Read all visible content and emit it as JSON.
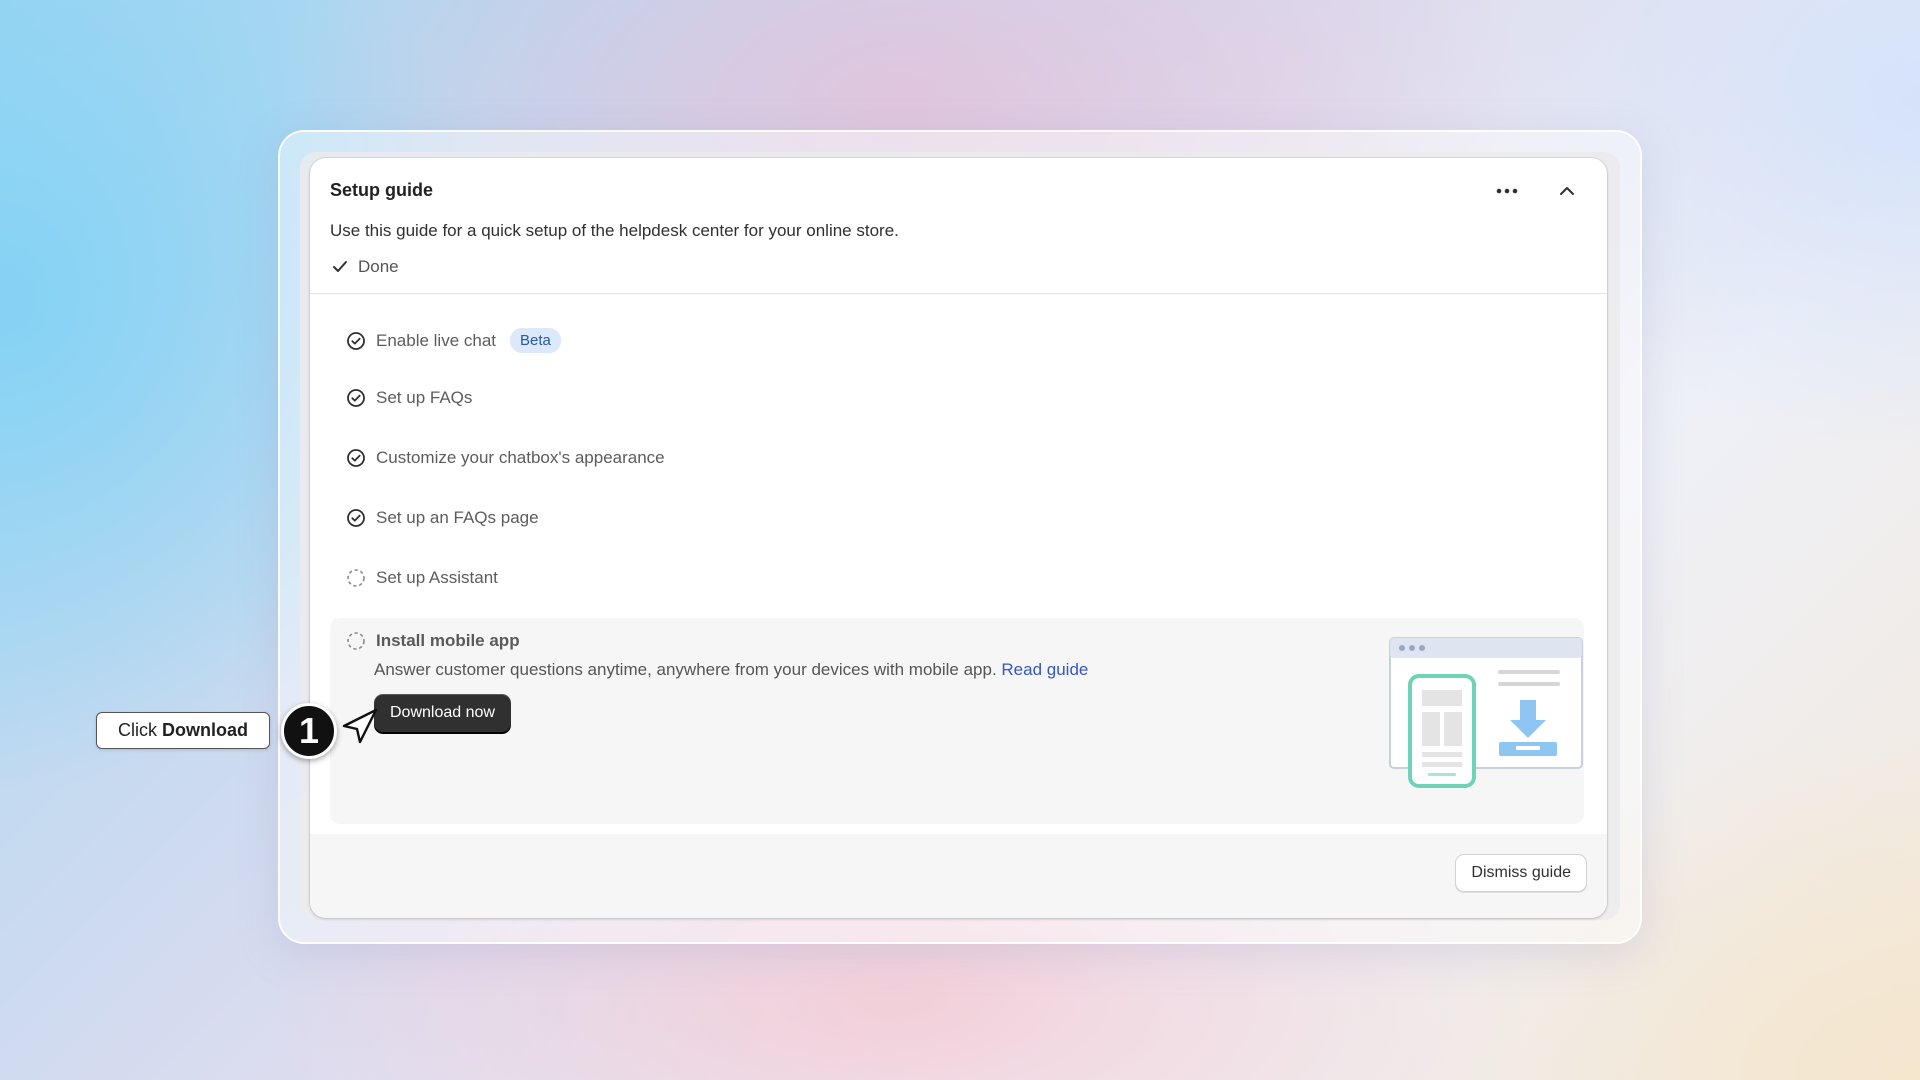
{
  "guide": {
    "title": "Setup guide",
    "subtitle": "Use this guide for a quick setup of the helpdesk center for your online store.",
    "done_label": "Done",
    "more_icon": "ellipsis-icon",
    "collapse_icon": "chevron-up-icon"
  },
  "tasks": [
    {
      "label": "Enable live chat",
      "status": "complete",
      "badge": "Beta"
    },
    {
      "label": "Set up FAQs",
      "status": "complete"
    },
    {
      "label": "Customize your chatbox's appearance",
      "status": "complete"
    },
    {
      "label": "Set up an FAQs page",
      "status": "complete"
    },
    {
      "label": "Set up Assistant",
      "status": "incomplete"
    }
  ],
  "expanded_task": {
    "title": "Install mobile app",
    "status": "incomplete",
    "description": "Answer customer questions anytime, anywhere from your devices with mobile app.",
    "link_label": "Read guide",
    "button_label": "Download now"
  },
  "footer": {
    "dismiss_label": "Dismiss guide"
  },
  "annotation": {
    "step_number": "1",
    "callout_prefix": "Click",
    "callout_emphasis": "Download"
  },
  "colors": {
    "link": "#3556c4",
    "beta_bg": "#dbe9fb",
    "beta_text": "#2b57a4",
    "primary_button": "#303030",
    "illustration_green": "#6fd3b8",
    "illustration_blue": "#8ec5f2"
  }
}
